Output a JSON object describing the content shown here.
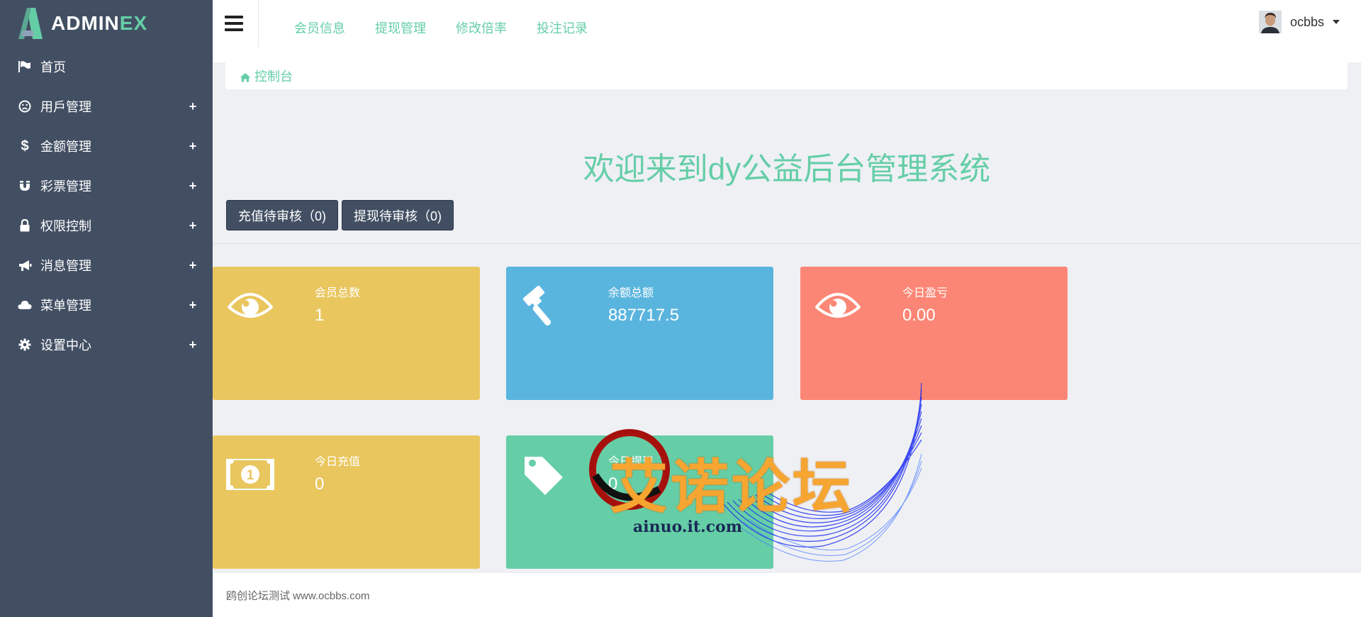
{
  "brand": {
    "name_main": "ADMIN",
    "name_accent": "EX"
  },
  "colors": {
    "sidebar": "#424f63",
    "accent": "#65cea7",
    "yellow": "#e9c65e",
    "blue": "#5ab5de",
    "red": "#fc8675",
    "green": "#65cea7"
  },
  "sidebar": {
    "items": [
      {
        "label": "首页",
        "icon": "flag-icon",
        "expandable": false
      },
      {
        "label": "用戶管理",
        "icon": "user-face-icon",
        "expandable": true
      },
      {
        "label": "金额管理",
        "icon": "dollar-icon",
        "expandable": true
      },
      {
        "label": "彩票管理",
        "icon": "magnet-icon",
        "expandable": true
      },
      {
        "label": "权限控制",
        "icon": "lock-icon",
        "expandable": true
      },
      {
        "label": "消息管理",
        "icon": "bullhorn-icon",
        "expandable": true
      },
      {
        "label": "菜单管理",
        "icon": "cloud-icon",
        "expandable": true
      },
      {
        "label": "设置中心",
        "icon": "gear-icon",
        "expandable": true
      }
    ],
    "expand_symbol": "+"
  },
  "topnav": [
    "会员信息",
    "提现管理",
    "修改倍率",
    "投注记录"
  ],
  "user": {
    "name": "ocbbs"
  },
  "breadcrumb": {
    "label": "控制台"
  },
  "welcome": "欢迎来到dy公益后台管理系统",
  "pending": {
    "recharge": "充值待审核（0)",
    "withdraw": "提现待审核（0)"
  },
  "stats": [
    {
      "title": "会员总数",
      "value": "1",
      "icon": "eye-icon"
    },
    {
      "title": "余额总额",
      "value": "887717.5",
      "icon": "gavel-icon"
    },
    {
      "title": "今日盈亏",
      "value": "0.00",
      "icon": "eye-icon"
    },
    {
      "title": "今日充值",
      "value": "0",
      "icon": "money-icon"
    },
    {
      "title": "今日提现",
      "value": "0",
      "icon": "tag-icon"
    }
  ],
  "footer": "鸥创论坛测试 www.ocbbs.com",
  "watermark": {
    "text": "艾诺论坛",
    "sub": "ainuo.it.com"
  }
}
